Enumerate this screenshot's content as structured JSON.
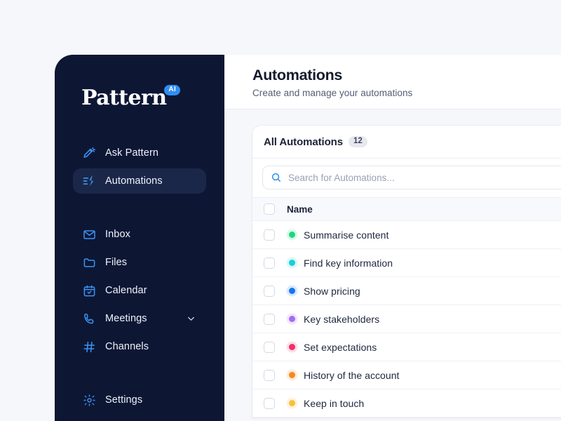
{
  "brand": {
    "name": "Pattern",
    "badge": "AI",
    "badge_color": "#2f8ef4",
    "sidebar_bg": "#0d1734",
    "accent": "#3b93f7"
  },
  "sidebar": {
    "items": [
      {
        "label": "Ask Pattern",
        "icon": "magic-wand-icon",
        "active": false,
        "expandable": false
      },
      {
        "label": "Automations",
        "icon": "automation-bolt-icon",
        "active": true,
        "expandable": false
      },
      {
        "label": "Inbox",
        "icon": "envelope-icon",
        "active": false,
        "expandable": false
      },
      {
        "label": "Files",
        "icon": "folder-icon",
        "active": false,
        "expandable": false
      },
      {
        "label": "Calendar",
        "icon": "calendar-check-icon",
        "active": false,
        "expandable": false
      },
      {
        "label": "Meetings",
        "icon": "phone-icon",
        "active": false,
        "expandable": true
      },
      {
        "label": "Channels",
        "icon": "hash-icon",
        "active": false,
        "expandable": false
      },
      {
        "label": "Settings",
        "icon": "gear-icon",
        "active": false,
        "expandable": false
      }
    ]
  },
  "header": {
    "title": "Automations",
    "subtitle": "Create and manage your automations"
  },
  "card": {
    "tab_label": "All Automations",
    "tab_count": "12",
    "search": {
      "placeholder": "Search for Automations...",
      "value": "",
      "icon": "search-icon"
    },
    "table": {
      "columns": [
        "Name"
      ],
      "rows": [
        {
          "name": "Summarise content",
          "color": "#1ed77f"
        },
        {
          "name": "Find key information",
          "color": "#19cfd8"
        },
        {
          "name": "Show pricing",
          "color": "#1477f0"
        },
        {
          "name": "Key stakeholders",
          "color": "#a66bf5"
        },
        {
          "name": "Set expectations",
          "color": "#f02e6a"
        },
        {
          "name": "History of the account",
          "color": "#f7871f"
        },
        {
          "name": "Keep in touch",
          "color": "#fbbf3b"
        }
      ]
    }
  }
}
